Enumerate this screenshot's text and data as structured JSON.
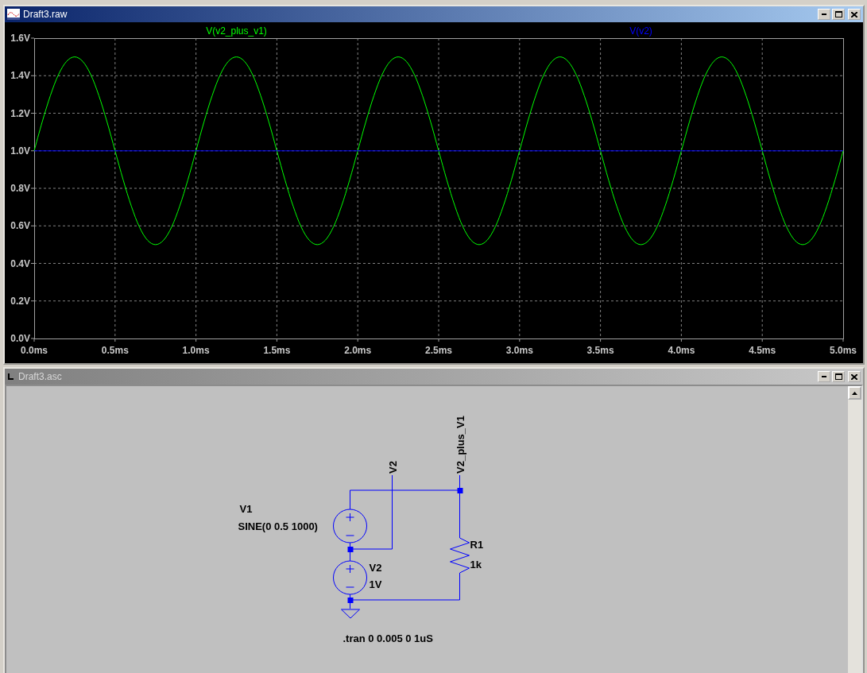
{
  "plot_window": {
    "title": "Draft3.raw",
    "active": true,
    "chart_data": {
      "type": "line",
      "grid": true,
      "xlim": [
        0,
        5
      ],
      "ylim": [
        0,
        1.6
      ],
      "xticks": [
        {
          "value": 0,
          "label": "0.0ms"
        },
        {
          "value": 0.5,
          "label": "0.5ms"
        },
        {
          "value": 1,
          "label": "1.0ms"
        },
        {
          "value": 1.5,
          "label": "1.5ms"
        },
        {
          "value": 2,
          "label": "2.0ms"
        },
        {
          "value": 2.5,
          "label": "2.5ms"
        },
        {
          "value": 3,
          "label": "3.0ms"
        },
        {
          "value": 3.5,
          "label": "3.5ms"
        },
        {
          "value": 4,
          "label": "4.0ms"
        },
        {
          "value": 4.5,
          "label": "4.5ms"
        },
        {
          "value": 5,
          "label": "5.0ms"
        }
      ],
      "yticks": [
        {
          "value": 0,
          "label": "0.0V"
        },
        {
          "value": 0.2,
          "label": "0.2V"
        },
        {
          "value": 0.4,
          "label": "0.4V"
        },
        {
          "value": 0.6,
          "label": "0.6V"
        },
        {
          "value": 0.8,
          "label": "0.8V"
        },
        {
          "value": 1,
          "label": "1.0V"
        },
        {
          "value": 1.2,
          "label": "1.2V"
        },
        {
          "value": 1.4,
          "label": "1.4V"
        },
        {
          "value": 1.6,
          "label": "1.6V"
        }
      ],
      "x": [
        0,
        0.05,
        0.1,
        0.15,
        0.2,
        0.25,
        0.3,
        0.35,
        0.4,
        0.45,
        0.5,
        0.55,
        0.6,
        0.65,
        0.7,
        0.75,
        0.8,
        0.85,
        0.9,
        0.95,
        1,
        1.05,
        1.1,
        1.15,
        1.2,
        1.25,
        1.3,
        1.35,
        1.4,
        1.45,
        1.5,
        1.55,
        1.6,
        1.65,
        1.7,
        1.75,
        1.8,
        1.85,
        1.9,
        1.95,
        2,
        2.05,
        2.1,
        2.15,
        2.2,
        2.25,
        2.3,
        2.35,
        2.4,
        2.45,
        2.5,
        2.55,
        2.6,
        2.65,
        2.7,
        2.75,
        2.8,
        2.85,
        2.9,
        2.95,
        3,
        3.05,
        3.1,
        3.15,
        3.2,
        3.25,
        3.3,
        3.35,
        3.4,
        3.45,
        3.5,
        3.55,
        3.6,
        3.65,
        3.7,
        3.75,
        3.8,
        3.85,
        3.9,
        3.95,
        4,
        4.05,
        4.1,
        4.15,
        4.2,
        4.25,
        4.3,
        4.35,
        4.4,
        4.45,
        4.5,
        4.55,
        4.6,
        4.65,
        4.7,
        4.75,
        4.8,
        4.85,
        4.9,
        4.95,
        5
      ],
      "series": [
        {
          "name": "V(v2_plus_v1)",
          "color": "#00ff00",
          "values": [
            1,
            1.155,
            1.294,
            1.405,
            1.476,
            1.5,
            1.476,
            1.405,
            1.294,
            1.155,
            1,
            0.845,
            0.706,
            0.595,
            0.524,
            0.5,
            0.524,
            0.595,
            0.706,
            0.845,
            1,
            1.155,
            1.294,
            1.405,
            1.476,
            1.5,
            1.476,
            1.405,
            1.294,
            1.155,
            1,
            0.845,
            0.706,
            0.595,
            0.524,
            0.5,
            0.524,
            0.595,
            0.706,
            0.845,
            1,
            1.155,
            1.294,
            1.405,
            1.476,
            1.5,
            1.476,
            1.405,
            1.294,
            1.155,
            1,
            0.845,
            0.706,
            0.595,
            0.524,
            0.5,
            0.524,
            0.595,
            0.706,
            0.845,
            1,
            1.155,
            1.294,
            1.405,
            1.476,
            1.5,
            1.476,
            1.405,
            1.294,
            1.155,
            1,
            0.845,
            0.706,
            0.595,
            0.524,
            0.5,
            0.524,
            0.595,
            0.706,
            0.845,
            1,
            1.155,
            1.294,
            1.405,
            1.476,
            1.5,
            1.476,
            1.405,
            1.294,
            1.155,
            1,
            0.845,
            0.706,
            0.595,
            0.524,
            0.5,
            0.524,
            0.595,
            0.706,
            0.845,
            1
          ]
        },
        {
          "name": "V(v2)",
          "color": "#0000ff",
          "values": [
            1,
            1,
            1,
            1,
            1,
            1,
            1,
            1,
            1,
            1,
            1,
            1,
            1,
            1,
            1,
            1,
            1,
            1,
            1,
            1,
            1,
            1,
            1,
            1,
            1,
            1,
            1,
            1,
            1,
            1,
            1,
            1,
            1,
            1,
            1,
            1,
            1,
            1,
            1,
            1,
            1,
            1,
            1,
            1,
            1,
            1,
            1,
            1,
            1,
            1,
            1,
            1,
            1,
            1,
            1,
            1,
            1,
            1,
            1,
            1,
            1,
            1,
            1,
            1,
            1,
            1,
            1,
            1,
            1,
            1,
            1,
            1,
            1,
            1,
            1,
            1,
            1,
            1,
            1,
            1,
            1,
            1,
            1,
            1,
            1,
            1,
            1,
            1,
            1,
            1,
            1,
            1,
            1,
            1,
            1,
            1,
            1,
            1,
            1,
            1,
            1
          ]
        }
      ]
    }
  },
  "schematic_window": {
    "title": "Draft3.asc",
    "active": false,
    "net_labels": [
      "V2_plus_V1",
      "V2"
    ],
    "components": [
      {
        "kind": "voltage_source",
        "name": "V1",
        "value": "SINE(0 0.5 1000)"
      },
      {
        "kind": "voltage_source",
        "name": "V2",
        "value": "1V"
      },
      {
        "kind": "resistor",
        "name": "R1",
        "value": "1k"
      }
    ],
    "directive": ".tran 0 0.005 0 1uS"
  }
}
